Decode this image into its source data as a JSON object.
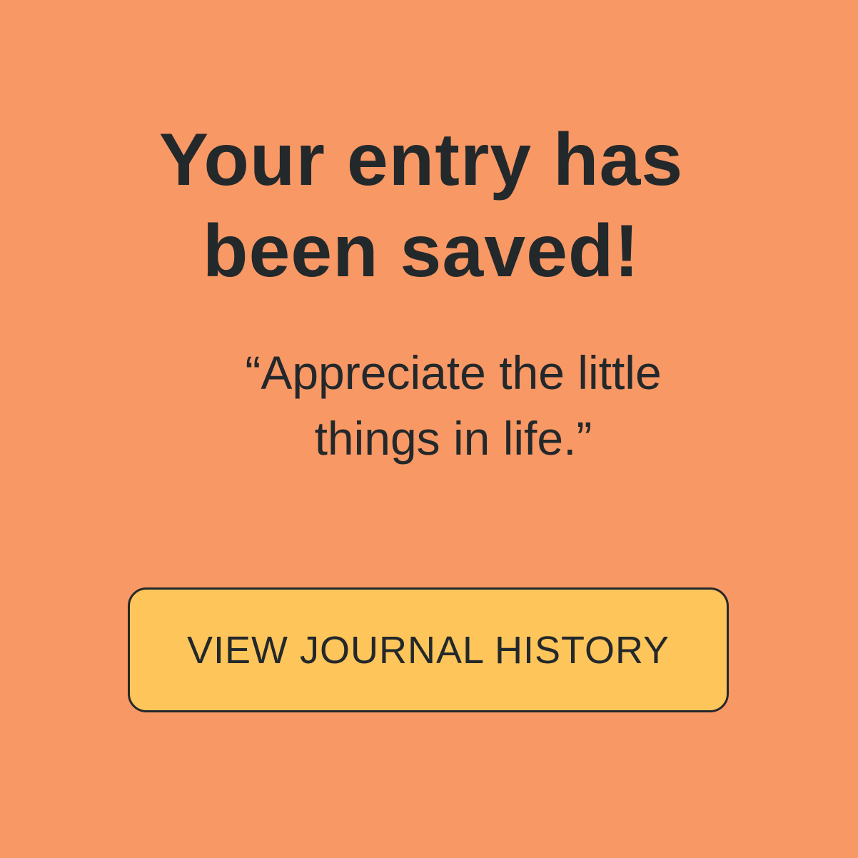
{
  "confirmation": {
    "title": "Your entry has been saved!",
    "quote": "“Appreciate the little things in life.”",
    "button_label": "VIEW JOURNAL HISTORY"
  },
  "colors": {
    "background": "#F89865",
    "button": "#FEC55A",
    "text": "#23282B"
  }
}
